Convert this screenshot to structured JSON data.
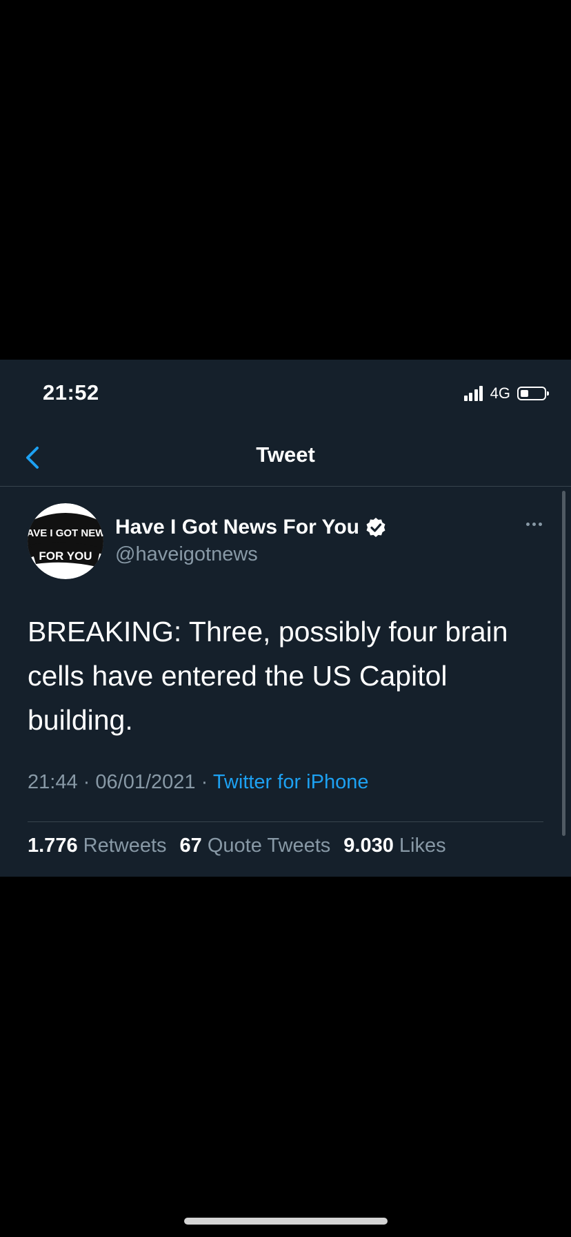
{
  "status_bar": {
    "time": "21:52",
    "network": "4G",
    "battery_level": 0.3
  },
  "nav": {
    "title": "Tweet",
    "back_icon": "chevron-left-icon"
  },
  "tweet": {
    "avatar_text_line1": "HAVE I GOT NEWS",
    "avatar_text_line2": "FOR YOU",
    "display_name": "Have I Got News For You",
    "handle": "@haveigotnews",
    "text": "BREAKING: Three, possibly four brain cells have entered the US Capitol building.",
    "time": "21:44",
    "date": "06/01/2021",
    "separator": "·",
    "source": "Twitter for iPhone",
    "stats": [
      {
        "count": "1.776",
        "label": "Retweets"
      },
      {
        "count": "67",
        "label": "Quote Tweets"
      },
      {
        "count": "9.030",
        "label": "Likes"
      }
    ]
  },
  "colors": {
    "background": "#15202b",
    "accent": "#1da1f2",
    "secondary_text": "#8899a6",
    "divider": "#38444d"
  }
}
